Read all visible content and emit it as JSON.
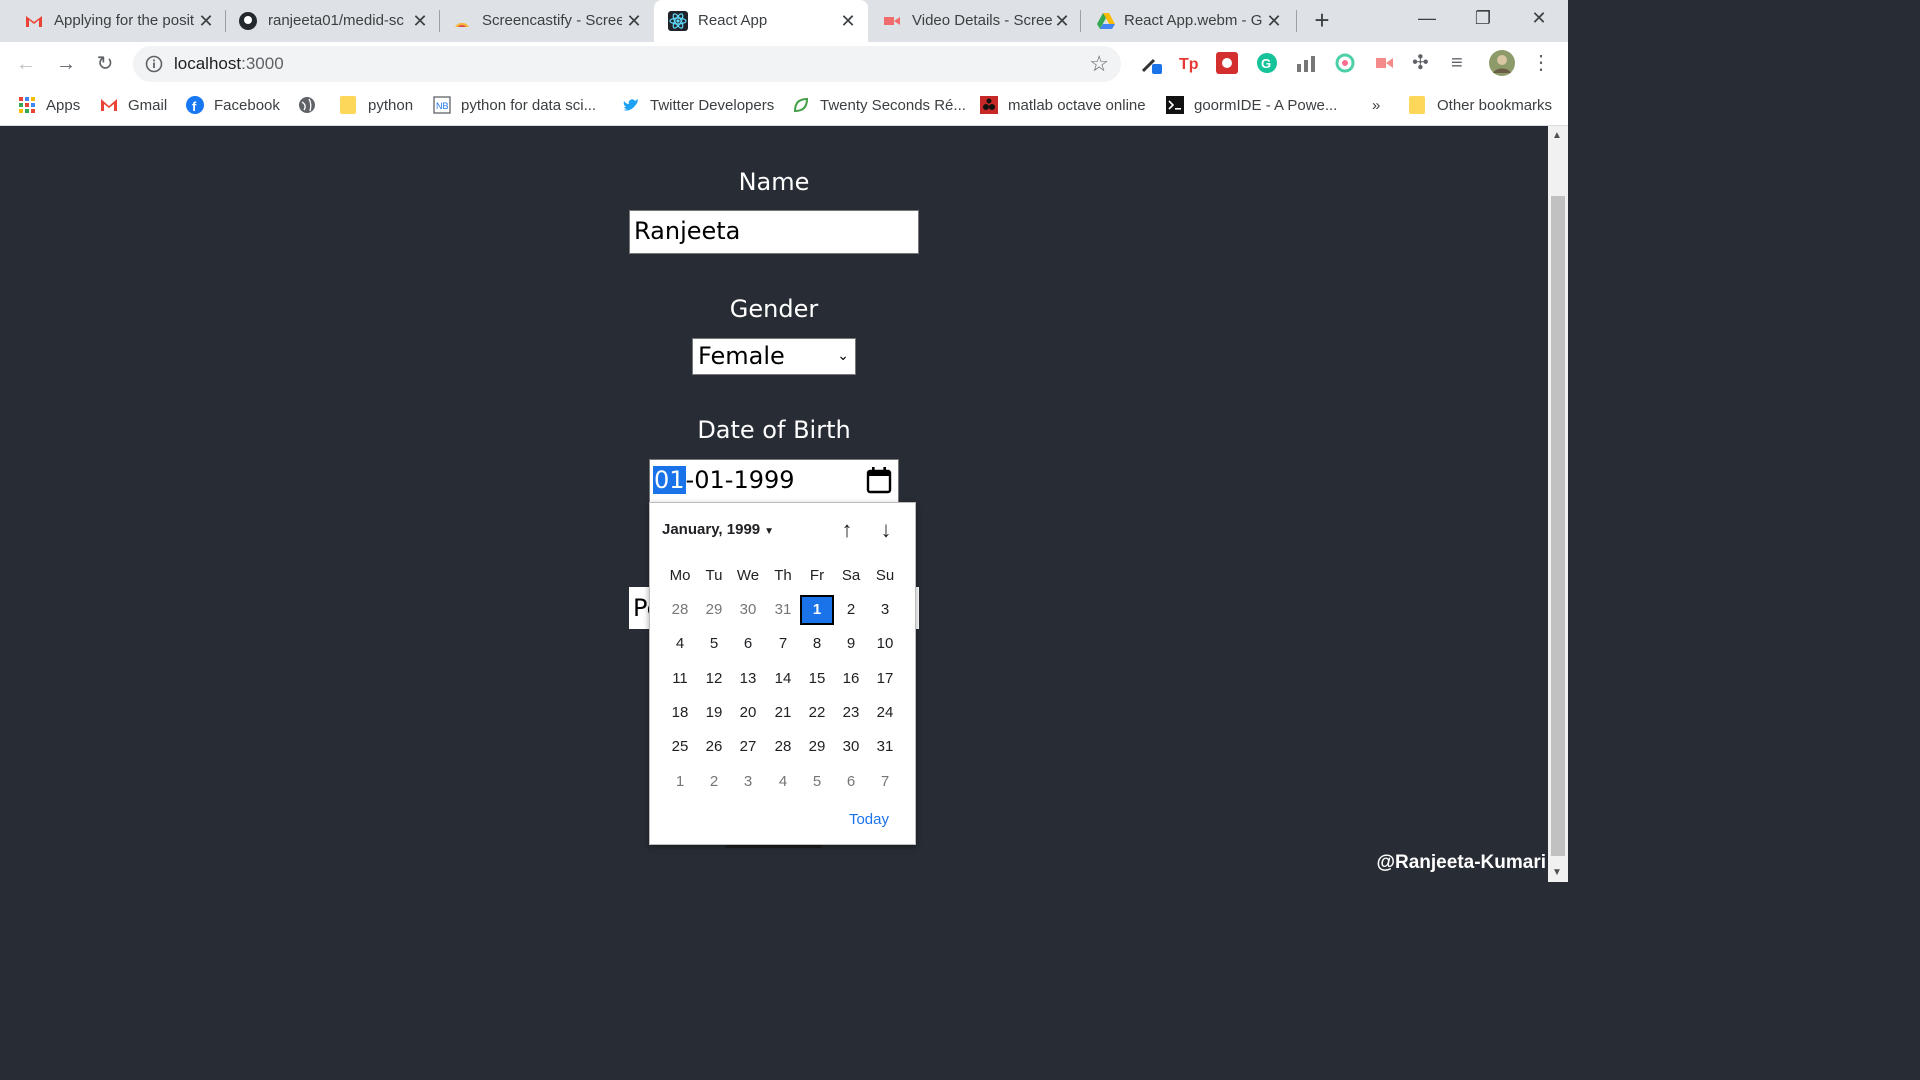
{
  "browser": {
    "tabs": [
      {
        "title": "Applying for the position",
        "icon": "gmail-icon",
        "active": false
      },
      {
        "title": "ranjeeta01/medid-sc",
        "icon": "github-icon",
        "active": false
      },
      {
        "title": "Screencastify - Screen",
        "icon": "screencastify-icon",
        "active": false
      },
      {
        "title": "React App",
        "icon": "react-icon",
        "active": true
      },
      {
        "title": "Video Details - Scree",
        "icon": "screencastify-video-icon",
        "active": false
      },
      {
        "title": "React App.webm - G",
        "icon": "drive-icon",
        "active": false
      }
    ],
    "url_host": "localhost",
    "url_port": ":3000",
    "bookmarks": [
      {
        "label": "Apps",
        "icon": "apps-grid-icon"
      },
      {
        "label": "Gmail",
        "icon": "gmail-icon"
      },
      {
        "label": "Facebook",
        "icon": "facebook-icon"
      },
      {
        "label": "",
        "icon": "globe-icon"
      },
      {
        "label": "python",
        "icon": "folder-icon"
      },
      {
        "label": "python for data sci...",
        "icon": "notebook-icon"
      },
      {
        "label": "Twitter Developers",
        "icon": "twitter-icon"
      },
      {
        "label": "Twenty Seconds Ré...",
        "icon": "leaf-icon"
      },
      {
        "label": "matlab octave online",
        "icon": "octave-icon"
      },
      {
        "label": "goormIDE - A Powe...",
        "icon": "terminal-icon"
      }
    ],
    "more_bookmarks": "»",
    "other_bookmarks": "Other bookmarks"
  },
  "form": {
    "name_label": "Name",
    "name_value": "Ranjeeta",
    "gender_label": "Gender",
    "gender_value": "Female",
    "dob_label": "Date of Birth",
    "dob_day": "01",
    "dob_sep": "-",
    "dob_month": "01",
    "dob_year": "1999",
    "hidden_field_value": "Pe"
  },
  "calendar": {
    "month_label": "January, 1999",
    "weekdays": [
      "Mo",
      "Tu",
      "We",
      "Th",
      "Fr",
      "Sa",
      "Su"
    ],
    "weeks": [
      [
        {
          "d": "28",
          "o": true
        },
        {
          "d": "29",
          "o": true
        },
        {
          "d": "30",
          "o": true
        },
        {
          "d": "31",
          "o": true
        },
        {
          "d": "1",
          "o": false,
          "sel": true
        },
        {
          "d": "2",
          "o": false
        },
        {
          "d": "3",
          "o": false
        }
      ],
      [
        {
          "d": "4"
        },
        {
          "d": "5"
        },
        {
          "d": "6"
        },
        {
          "d": "7"
        },
        {
          "d": "8"
        },
        {
          "d": "9"
        },
        {
          "d": "10"
        }
      ],
      [
        {
          "d": "11"
        },
        {
          "d": "12"
        },
        {
          "d": "13"
        },
        {
          "d": "14"
        },
        {
          "d": "15"
        },
        {
          "d": "16"
        },
        {
          "d": "17"
        }
      ],
      [
        {
          "d": "18"
        },
        {
          "d": "19"
        },
        {
          "d": "20"
        },
        {
          "d": "21"
        },
        {
          "d": "22"
        },
        {
          "d": "23"
        },
        {
          "d": "24"
        }
      ],
      [
        {
          "d": "25"
        },
        {
          "d": "26"
        },
        {
          "d": "27"
        },
        {
          "d": "28"
        },
        {
          "d": "29"
        },
        {
          "d": "30"
        },
        {
          "d": "31"
        }
      ],
      [
        {
          "d": "1",
          "o": true
        },
        {
          "d": "2",
          "o": true
        },
        {
          "d": "3",
          "o": true
        },
        {
          "d": "4",
          "o": true
        },
        {
          "d": "5",
          "o": true
        },
        {
          "d": "6",
          "o": true
        },
        {
          "d": "7",
          "o": true
        }
      ]
    ],
    "today_label": "Today"
  },
  "watermark": "@Ranjeeta-Kumari",
  "colors": {
    "page_bg": "#282c34",
    "accent": "#1a73e8"
  }
}
